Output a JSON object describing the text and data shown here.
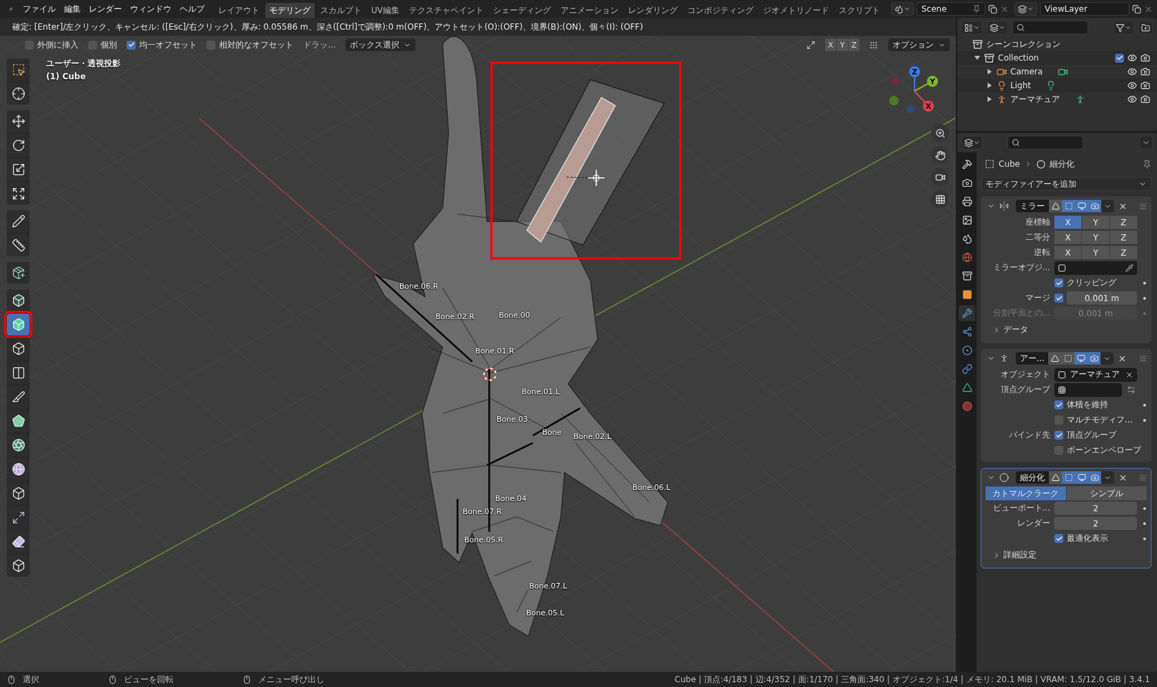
{
  "top_bar": {
    "menu": [
      "ファイル",
      "編集",
      "レンダー",
      "ウィンドウ",
      "ヘルプ"
    ],
    "workspaces": [
      {
        "label": "レイアウト",
        "selected": false
      },
      {
        "label": "モデリング",
        "selected": true
      },
      {
        "label": "スカルプト",
        "selected": false
      },
      {
        "label": "UV編集",
        "selected": false
      },
      {
        "label": "テクスチャペイント",
        "selected": false
      },
      {
        "label": "シェーディング",
        "selected": false
      },
      {
        "label": "アニメーション",
        "selected": false
      },
      {
        "label": "レンダリング",
        "selected": false
      },
      {
        "label": "コンポジティング",
        "selected": false
      },
      {
        "label": "ジオメトリノード",
        "selected": false
      },
      {
        "label": "スクリプト",
        "selected": false
      }
    ],
    "scene": "Scene",
    "view_layer": "ViewLayer"
  },
  "viewport": {
    "operator_hint": "確定: [Enter]/左クリック、キャンセル: ([Esc]/右クリック)、厚み: 0.05586 m、深さ([Ctrl]で調整):0 m(OFF)、アウトセット(O):(OFF)、境界(B):(ON)、個々(I): (OFF)",
    "tool_options": {
      "checkboxes": [
        {
          "label": "外側に挿入",
          "checked": false
        },
        {
          "label": "個別",
          "checked": false
        },
        {
          "label": "均一オフセット",
          "checked": true
        },
        {
          "label": "相対的なオフセット",
          "checked": false
        }
      ],
      "drag_label": "ドラッ...",
      "select_mode": "ボックス選択",
      "axes": [
        {
          "label": "X",
          "selected": false
        },
        {
          "label": "Y",
          "selected": false
        },
        {
          "label": "Z",
          "selected": false
        }
      ],
      "options": "オプション"
    },
    "view_name": "ユーザー・透視投影",
    "object_name": "(1) Cube",
    "bone_labels": [
      "Bone.06.R",
      "Bone.02.R",
      "Bone.00",
      "Bone.01.R",
      "Bone.01.L",
      "Bone.03",
      "Bone",
      "Bone.02.L",
      "Bone.06.L",
      "Bone.04",
      "Bone.07.R",
      "Bone.05.R",
      "Bone.07.L",
      "Bone.05.L"
    ],
    "gizmo_axes": [
      "Z",
      "Y",
      "X"
    ]
  },
  "toolbar": [
    {
      "kind": "select",
      "selected": false
    },
    {
      "kind": "cursor",
      "selected": false
    },
    {
      "kind": "move",
      "selected": false
    },
    {
      "kind": "rotate",
      "selected": false
    },
    {
      "kind": "scale",
      "selected": false
    },
    {
      "kind": "transform",
      "selected": false
    },
    {
      "kind": "annotate",
      "selected": false
    },
    {
      "kind": "measure",
      "selected": false
    },
    {
      "kind": "add_cube",
      "selected": false
    },
    {
      "kind": "extrude",
      "selected": false
    },
    {
      "kind": "inset",
      "selected": true
    },
    {
      "kind": "bevel",
      "selected": false
    },
    {
      "kind": "loop_cut",
      "selected": false
    },
    {
      "kind": "knife",
      "selected": false
    },
    {
      "kind": "poly_build",
      "selected": false
    },
    {
      "kind": "spin",
      "selected": false
    },
    {
      "kind": "smooth",
      "selected": false
    },
    {
      "kind": "edge_slide",
      "selected": false
    },
    {
      "kind": "shrink",
      "selected": false
    },
    {
      "kind": "shear",
      "selected": false
    },
    {
      "kind": "rip",
      "selected": false
    }
  ],
  "outliner": {
    "root": "シーンコレクション",
    "items": [
      {
        "label": "Collection",
        "kind": "collection",
        "expanded": true,
        "checked": true,
        "children": [
          {
            "label": "Camera",
            "kind": "camera",
            "expanded": false
          },
          {
            "label": "Light",
            "kind": "light",
            "expanded": false
          },
          {
            "label": "アーマチュア",
            "kind": "armature",
            "expanded": false
          }
        ]
      }
    ]
  },
  "properties": {
    "tabs": [
      {
        "kind": "tool",
        "selected": false
      },
      {
        "kind": "render",
        "selected": false
      },
      {
        "kind": "output",
        "selected": false
      },
      {
        "kind": "view_layer",
        "selected": false
      },
      {
        "kind": "scene",
        "selected": false
      },
      {
        "kind": "world",
        "selected": false
      },
      {
        "kind": "collection",
        "selected": false
      },
      {
        "kind": "object",
        "selected": false
      },
      {
        "kind": "modifiers",
        "selected": true
      },
      {
        "kind": "particles",
        "selected": false
      },
      {
        "kind": "physics",
        "selected": false
      },
      {
        "kind": "constraints",
        "selected": false
      },
      {
        "kind": "data",
        "selected": false
      },
      {
        "kind": "material",
        "selected": false
      }
    ],
    "breadcrumb": [
      "Cube",
      "細分化"
    ],
    "add_modifier": "モディファイアーを追加",
    "modifiers": [
      {
        "kind": "mirror",
        "name": "ミラー",
        "expanded": true,
        "active": false,
        "toggles": [
          {
            "kind": "edit_mode",
            "on": false
          },
          {
            "kind": "on_cage",
            "on": true
          },
          {
            "kind": "viewport",
            "on": true
          },
          {
            "kind": "render",
            "on": true
          }
        ],
        "rows": [
          {
            "kind": "axes",
            "label": "座標軸",
            "axes": [
              {
                "label": "X",
                "selected": true
              },
              {
                "label": "Y",
                "selected": false
              },
              {
                "label": "Z",
                "selected": false
              }
            ]
          },
          {
            "kind": "axes",
            "label": "二等分",
            "axes": [
              {
                "label": "X",
                "selected": false
              },
              {
                "label": "Y",
                "selected": false
              },
              {
                "label": "Z",
                "selected": false
              }
            ]
          },
          {
            "kind": "axes",
            "label": "逆転",
            "axes": [
              {
                "label": "X",
                "selected": false
              },
              {
                "label": "Y",
                "selected": false
              },
              {
                "label": "Z",
                "selected": false
              }
            ]
          },
          {
            "kind": "object",
            "label": "ミラーオブジ..."
          },
          {
            "kind": "check",
            "label": "クリッピング",
            "checked": true,
            "dot": true
          },
          {
            "kind": "check_number",
            "label": "マージ",
            "checked": true,
            "value": "0.001 m",
            "dot": true
          },
          {
            "kind": "number",
            "label": "分割平面との...",
            "value": "0.001 m",
            "disabled": true,
            "dot": true
          },
          {
            "kind": "subpanel",
            "label": "データ",
            "expanded": false
          }
        ]
      },
      {
        "kind": "armature",
        "name": "アー...",
        "expanded": true,
        "active": false,
        "toggles": [
          {
            "kind": "edit_mode",
            "on": false
          },
          {
            "kind": "on_cage",
            "on": false
          },
          {
            "kind": "viewport",
            "on": true
          },
          {
            "kind": "render",
            "on": true
          }
        ],
        "rows": [
          {
            "kind": "object",
            "label": "オブジェクト",
            "value": "アーマチュア"
          },
          {
            "kind": "group",
            "label": "頂点グループ"
          },
          {
            "kind": "check",
            "label": "体積を維持",
            "checked": true,
            "dot": true
          },
          {
            "kind": "check",
            "label": "マルチモディフ...",
            "checked": false,
            "dot": true
          },
          {
            "kind": "check",
            "side_label": "バインド先",
            "label": "頂点グループ",
            "checked": true
          },
          {
            "kind": "check",
            "label": "ボーンエンベロープ",
            "checked": false
          }
        ]
      },
      {
        "kind": "subsurf",
        "name": "細分化",
        "expanded": true,
        "active": true,
        "toggles": [
          {
            "kind": "edit_mode",
            "on": false
          },
          {
            "kind": "on_cage",
            "on": true
          },
          {
            "kind": "viewport",
            "on": true
          },
          {
            "kind": "render",
            "on": true
          }
        ],
        "rows": [
          {
            "kind": "segmented",
            "options": [
              {
                "label": "カトマルクラーク",
                "selected": true
              },
              {
                "label": "シンプル",
                "selected": false
              }
            ]
          },
          {
            "kind": "number",
            "label": "ビューポート...",
            "value": "2",
            "dot": true
          },
          {
            "kind": "number",
            "label": "レンダー",
            "value": "2",
            "dot": true
          },
          {
            "kind": "check",
            "label": "最適化表示",
            "checked": true,
            "dot": true
          },
          {
            "kind": "subpanel",
            "label": "詳細設定",
            "expanded": false
          }
        ]
      }
    ]
  },
  "status_bar": {
    "hints": [
      "選択",
      "ビューを回転",
      "メニュー呼び出し"
    ],
    "stats": "Cube | 頂点:4/183 | 辺:4/352 | 面:1/170 | 三角面:340 | オブジェクト:1/4 | メモリ: 20.1 MiB | VRAM: 1.5/12.0 GiB | 3.4.1"
  }
}
